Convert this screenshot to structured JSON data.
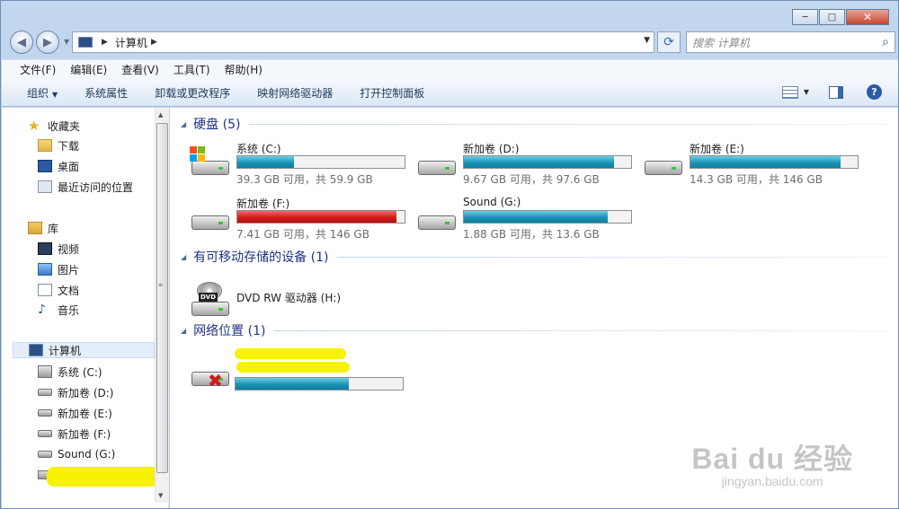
{
  "window": {
    "minimize_glyph": "─",
    "maximize_glyph": "□",
    "close_glyph": "✕"
  },
  "navigation": {
    "back_glyph": "◀",
    "forward_glyph": "▶",
    "address_crumb": "计算机",
    "refresh_glyph": "⟳",
    "search_placeholder": "搜索 计算机"
  },
  "menu": [
    "文件(F)",
    "编辑(E)",
    "查看(V)",
    "工具(T)",
    "帮助(H)"
  ],
  "toolbar": {
    "organize": "组织",
    "items": [
      "系统属性",
      "卸载或更改程序",
      "映射网络驱动器",
      "打开控制面板"
    ],
    "help_glyph": "?"
  },
  "sidebar": {
    "favorites": {
      "title": "收藏夹",
      "items": [
        "下载",
        "桌面",
        "最近访问的位置"
      ]
    },
    "libraries": {
      "title": "库",
      "items": [
        "视频",
        "图片",
        "文档",
        "音乐"
      ]
    },
    "computer": {
      "title": "计算机",
      "items": [
        "系统 (C:)",
        "新加卷 (D:)",
        "新加卷 (E:)",
        "新加卷 (F:)",
        "Sound (G:)"
      ]
    }
  },
  "groups": {
    "hard_disks": "硬盘 (5)",
    "removable": "有可移动存储的设备 (1)",
    "network": "网络位置 (1)"
  },
  "drives": [
    {
      "name": "系统 (C:)",
      "free_text": "39.3 GB 可用，共 59.9 GB",
      "used_fraction": 0.34,
      "color": "#1b93b6"
    },
    {
      "name": "新加卷 (D:)",
      "free_text": "9.67 GB 可用，共 97.6 GB",
      "used_fraction": 0.9,
      "color": "#1b93b6"
    },
    {
      "name": "新加卷 (E:)",
      "free_text": "14.3 GB 可用，共 146 GB",
      "used_fraction": 0.9,
      "color": "#1b93b6"
    },
    {
      "name": "新加卷 (F:)",
      "free_text": "7.41 GB 可用，共 146 GB",
      "used_fraction": 0.95,
      "color": "#d61a1a"
    },
    {
      "name": "Sound (G:)",
      "free_text": "1.88 GB 可用，共 13.6 GB",
      "used_fraction": 0.86,
      "color": "#1b93b6"
    }
  ],
  "removable": {
    "name": "DVD RW 驱动器 (H:)",
    "disc_label": "DVD"
  },
  "network_drive": {
    "used_fraction": 0.68,
    "status_icon": "red-x-icon"
  },
  "watermark": {
    "line1": "Bai du 经验",
    "line2": "jingyan.baidu.com"
  },
  "colors": {
    "accent": "#1e3287",
    "highlighter": "#f7f200"
  }
}
